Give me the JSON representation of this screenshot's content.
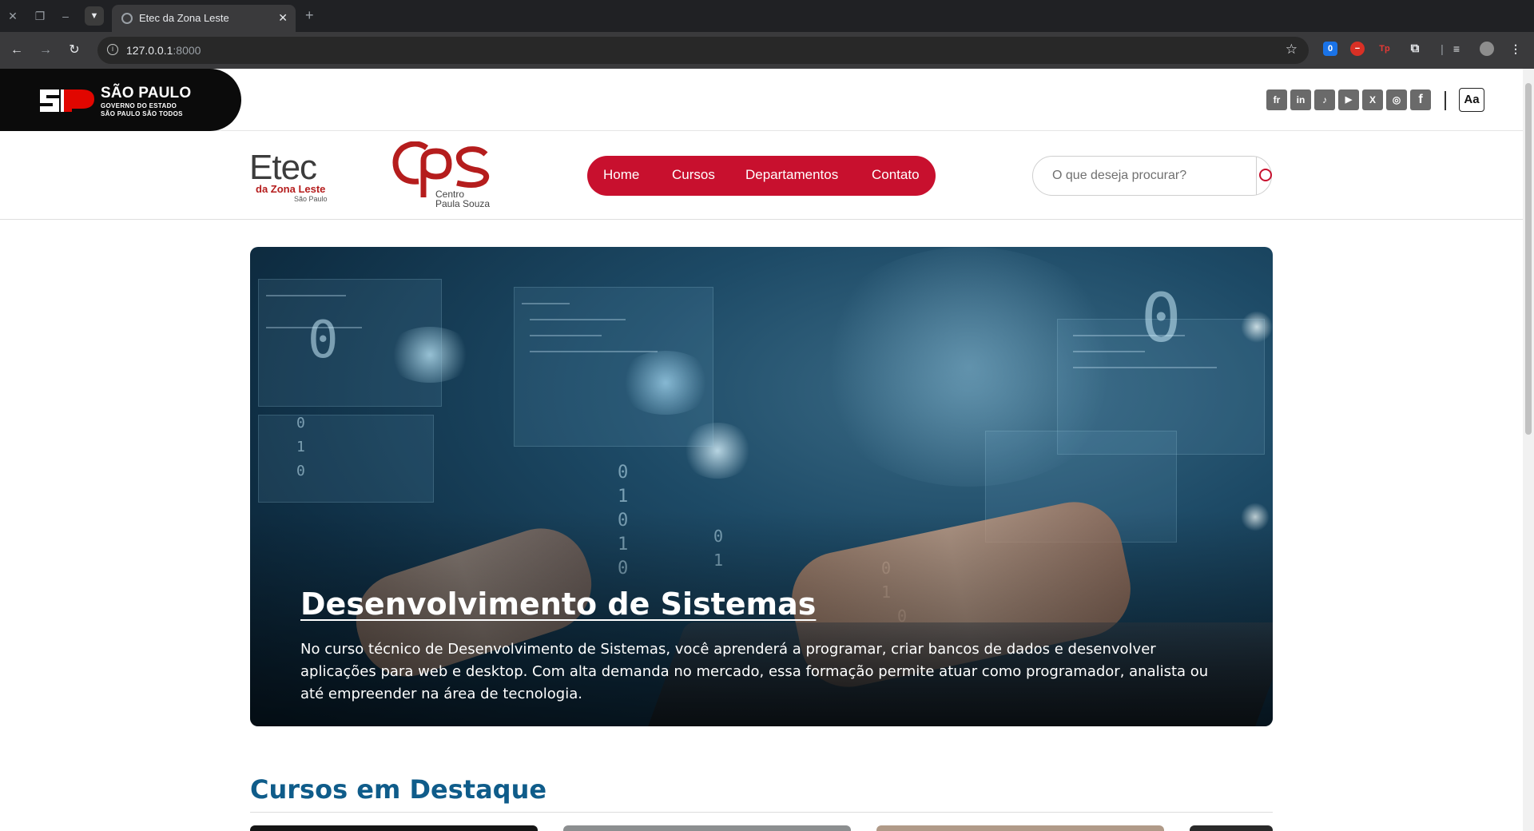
{
  "browser": {
    "tab_title": "Etec da Zona Leste",
    "new_tab_label": "+",
    "url_host": "127.0.0.1",
    "url_port": ":8000",
    "extensions": [
      {
        "name": "extension-badge-icon",
        "label": "0",
        "color": "#1a73e8"
      },
      {
        "name": "adblock-icon",
        "label": "−",
        "color": "#d93025"
      },
      {
        "name": "tp-extension-icon",
        "label": "Tp",
        "color": "#d93025"
      },
      {
        "name": "puzzle-icon",
        "label": "⧉",
        "color": "#5f6368"
      }
    ]
  },
  "gov_bar": {
    "logo_title": "SÃO PAULO",
    "logo_sub1": "GOVERNO DO ESTADO",
    "logo_sub2": "SÃO PAULO SÃO TODOS",
    "social": [
      {
        "name": "flickr-icon",
        "glyph": "fr"
      },
      {
        "name": "linkedin-icon",
        "glyph": "in"
      },
      {
        "name": "tiktok-icon",
        "glyph": "♪"
      },
      {
        "name": "youtube-icon",
        "glyph": "▶"
      },
      {
        "name": "x-icon",
        "glyph": "X"
      },
      {
        "name": "instagram-icon",
        "glyph": "◎"
      },
      {
        "name": "facebook-icon",
        "glyph": "f"
      }
    ],
    "font_size_label": "Aa"
  },
  "header": {
    "etec_word": "Etec",
    "etec_zona": "da Zona Leste",
    "etec_city": "São Paulo",
    "cps_line1": "Centro",
    "cps_line2": "Paula Souza",
    "nav": [
      "Home",
      "Cursos",
      "Departamentos",
      "Contato"
    ],
    "search_placeholder": "O que deseja procurar?"
  },
  "hero": {
    "title": "Desenvolvimento de Sistemas",
    "description": "No curso técnico de Desenvolvimento de Sistemas, você aprenderá a programar, criar bancos de dados e desenvolver aplicações para web e desktop. Com alta demanda no mercado, essa formação permite atuar como programador, analista ou até empreender na área de tecnologia."
  },
  "featured": {
    "title": "Cursos em Destaque"
  },
  "colors": {
    "brand_red": "#c8102e",
    "section_blue": "#0f5c8a"
  }
}
